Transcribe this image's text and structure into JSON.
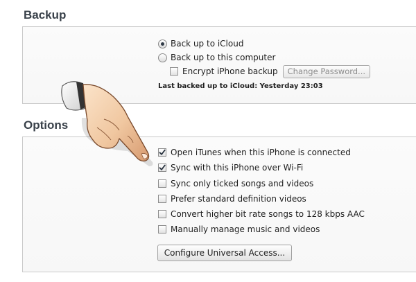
{
  "backup": {
    "title": "Backup",
    "option_icloud": "Back up to iCloud",
    "option_computer": "Back up to this computer",
    "encrypt_label": "Encrypt iPhone backup",
    "change_password_label": "Change Password...",
    "last_backup": "Last backed up to iCloud: Yesterday 23:03",
    "selected": "icloud",
    "encrypt_checked": false
  },
  "options": {
    "title": "Options",
    "items": [
      {
        "label": "Open iTunes when this iPhone is connected",
        "checked": true
      },
      {
        "label": "Sync with this iPhone over Wi-Fi",
        "checked": true
      },
      {
        "label": "Sync only ticked songs and videos",
        "checked": false
      },
      {
        "label": "Prefer standard definition videos",
        "checked": false
      },
      {
        "label": "Convert higher bit rate songs to 128 kbps AAC",
        "checked": false
      },
      {
        "label": "Manually manage music and videos",
        "checked": false
      }
    ],
    "universal_access_label": "Configure Universal Access..."
  },
  "overlay": {
    "icon": "pointing-hand-icon"
  }
}
